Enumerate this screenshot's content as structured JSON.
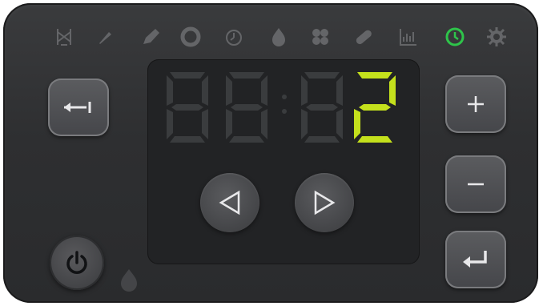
{
  "display": {
    "readout": "2",
    "digit_color": "#c4e01c",
    "off_segment_color": "#3a3c3e"
  },
  "icons": [
    {
      "name": "fir-tree-icon",
      "active": false
    },
    {
      "name": "brush-icon",
      "active": false
    },
    {
      "name": "pencil-icon",
      "active": false
    },
    {
      "name": "circle-ring-icon",
      "active": false
    },
    {
      "name": "timer-icon",
      "active": false
    },
    {
      "name": "flame-drop-icon",
      "active": false
    },
    {
      "name": "fan-icon",
      "active": false
    },
    {
      "name": "pill-icon",
      "active": false
    },
    {
      "name": "chart-icon",
      "active": false
    },
    {
      "name": "clock-icon",
      "active": true
    },
    {
      "name": "gear-icon",
      "active": false
    }
  ],
  "buttons": {
    "back": {
      "icon": "back-arrow-icon"
    },
    "plus": {
      "icon": "plus-icon"
    },
    "minus": {
      "icon": "minus-icon"
    },
    "enter": {
      "icon": "enter-arrow-icon"
    },
    "left": {
      "icon": "triangle-left-icon"
    },
    "right": {
      "icon": "triangle-right-icon"
    },
    "power": {
      "icon": "power-icon"
    }
  },
  "colors": {
    "panel": "#2e2f31",
    "active_icon": "#2ec44a",
    "inactive_icon": "#8a8b8e",
    "button_glyph": "#e8e8ea"
  }
}
